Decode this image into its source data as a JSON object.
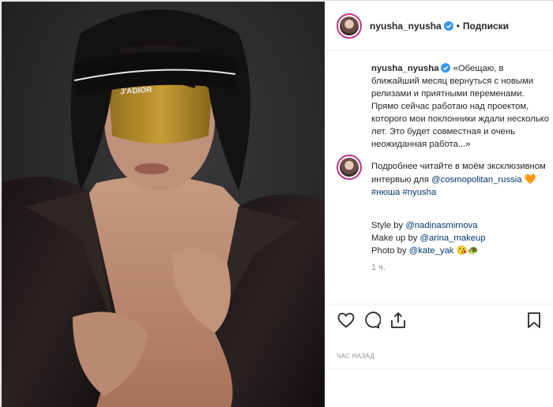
{
  "header": {
    "username": "nyusha_nyusha",
    "separator": "•",
    "follow_label": "Подписки"
  },
  "caption": {
    "username": "nyusha_nyusha",
    "paragraph1": "«Обещаю, в ближайший месяц вернуться с новыми релизами и приятными переменами. Прямо сейчас работаю над проектом, которого мои поклонники ждали несколько лет. Это будет совместная и очень неожиданная работа...»",
    "paragraph2_text": "Подробнее читайте в моём эксклюзивном интервью для",
    "mention_cosmo": "@cosmopolitan_russia",
    "heart_emoji": "🧡",
    "hashtag1": "#нюша",
    "hashtag2": "#nyusha",
    "credit_style_label": "Style by",
    "credit_style_user": "@nadinasmirnova",
    "credit_makeup_label": "Make up by",
    "credit_makeup_user": "@arina_makeup",
    "credit_photo_label": "Photo by",
    "credit_photo_user": "@kate_yak",
    "credit_emojis": "😘🐢",
    "time_ago": "1 ч."
  },
  "photo": {
    "headband_text": "J'ADIOR"
  },
  "actions": {
    "like_icon": "heart-outline-icon",
    "comment_icon": "speech-bubble-icon",
    "share_icon": "share-upload-icon",
    "save_icon": "bookmark-icon"
  },
  "timestamp": "час назад",
  "colors": {
    "avatar_ring": "#c13584",
    "verified_blue": "#3897f0",
    "mention": "#00376b",
    "muted": "#8e8e8e"
  }
}
